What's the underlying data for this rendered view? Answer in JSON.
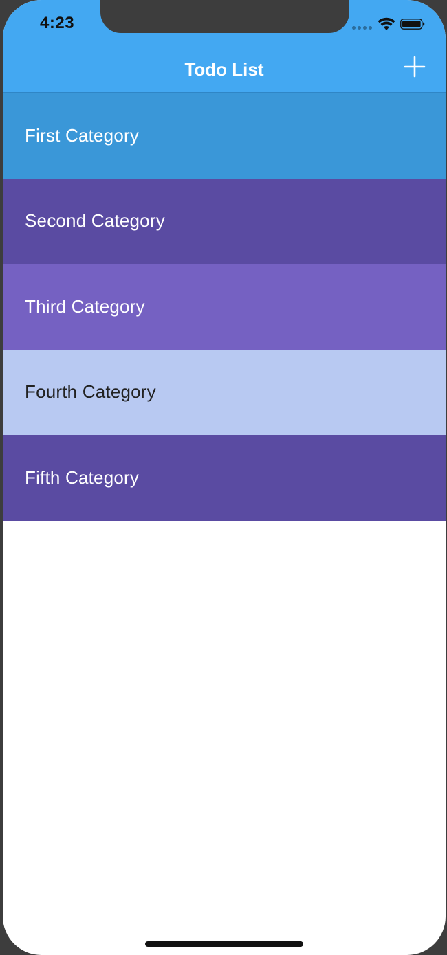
{
  "status_bar": {
    "time": "4:23"
  },
  "nav": {
    "title": "Todo List",
    "add_icon": "plus-icon"
  },
  "colors": {
    "nav_background": "#43a8f2",
    "background": "#ffffff"
  },
  "categories": [
    {
      "label": "First Category",
      "background": "#3a97d8",
      "text_color": "#ffffff"
    },
    {
      "label": "Second Category",
      "background": "#5a4ba2",
      "text_color": "#ffffff"
    },
    {
      "label": "Third Category",
      "background": "#7561c2",
      "text_color": "#ffffff"
    },
    {
      "label": "Fourth Category",
      "background": "#b8c9f2",
      "text_color": "#222222"
    },
    {
      "label": "Fifth Category",
      "background": "#5a4ba2",
      "text_color": "#ffffff"
    }
  ]
}
